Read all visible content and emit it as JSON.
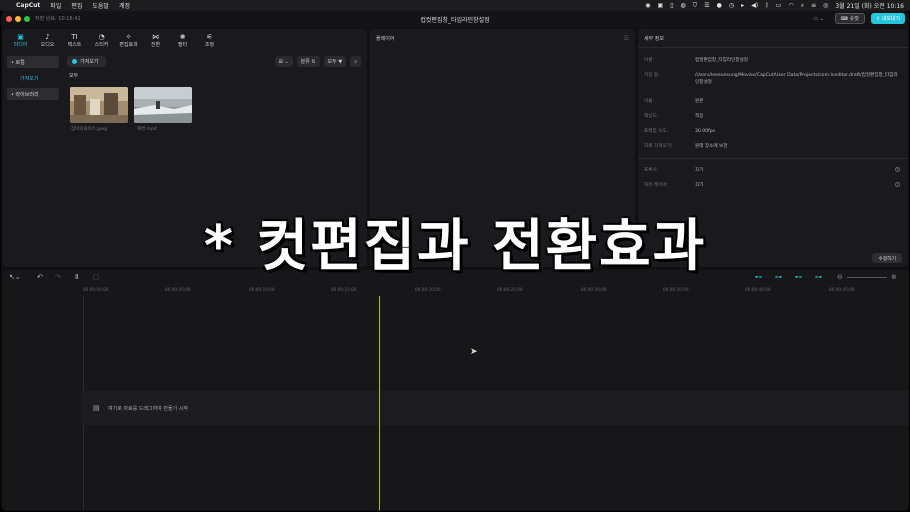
{
  "menubar": {
    "app_name": "CapCut",
    "menus": [
      "파일",
      "편집",
      "도움말",
      "계정"
    ],
    "clock": "3월 21일 (화) 오전 10:16"
  },
  "window": {
    "saved_text": "저장 완료: 10:16:41",
    "title": "컵컷편집창_타임라인창설정",
    "shortcut_label": "숏컷",
    "export_label": "내보내기"
  },
  "tool_tabs": [
    {
      "label": "미디어",
      "icon": "media-icon",
      "glyph": "▣",
      "active": true
    },
    {
      "label": "오디오",
      "icon": "audio-icon",
      "glyph": "♪",
      "active": false
    },
    {
      "label": "텍스트",
      "icon": "text-icon",
      "glyph": "TI",
      "active": false
    },
    {
      "label": "스티커",
      "icon": "sticker-icon",
      "glyph": "◔",
      "active": false
    },
    {
      "label": "편집효과",
      "icon": "effects-icon",
      "glyph": "✧",
      "active": false
    },
    {
      "label": "전환",
      "icon": "transition-icon",
      "glyph": "⋈",
      "active": false
    },
    {
      "label": "필터",
      "icon": "filter-icon",
      "glyph": "❀",
      "active": false
    },
    {
      "label": "조정",
      "icon": "adjust-icon",
      "glyph": "⚟",
      "active": false
    }
  ],
  "media_sidebar": {
    "local": "• 로컬",
    "import": "가져오기",
    "library": "• 라이브러리"
  },
  "media": {
    "import_button": "가져오기",
    "view_label": "⊞",
    "sort_label": "분류",
    "filter_label": "모두",
    "all_label": "모두",
    "items": [
      {
        "name": "장미의화이트.jpeg"
      },
      {
        "name": "해변.mp4"
      }
    ]
  },
  "player": {
    "title": "플레이어",
    "menu": "☰"
  },
  "details": {
    "title": "세부 정보",
    "rows": [
      {
        "key": "이름:",
        "value": "컵컷편집창_타임라인창설정"
      },
      {
        "key": "저장 동:",
        "value": "/Users/leeeunsung/Movies/CapCut/User Data/Projects/com.lveditor.draft/컵컷편집창_타임라인창설정"
      },
      {
        "key": "비율:",
        "value": "원본"
      },
      {
        "key": "해상도:",
        "value": "적응"
      },
      {
        "key": "프레임 속도:",
        "value": "30.00fps"
      },
      {
        "key": "자료 가져오기:",
        "value": "원래 장소에 보관"
      },
      {
        "key": "프록시:",
        "value": "끄기"
      },
      {
        "key": "자유 레이어:",
        "value": "끄기"
      }
    ],
    "modify_button": "수정하기"
  },
  "timeline": {
    "ticks": [
      "00:00:00:00",
      "00:00:05:00",
      "00:00:10:00",
      "00:00:15:00",
      "00:00:20:00",
      "00:00:25:00",
      "00:00:30:00",
      "00:00:35:00",
      "00:00:40:00",
      "00:00:45:00"
    ],
    "drop_hint": "여기로 자료를 드래그하여 만들기 시작"
  },
  "overlay_text": "* 컷편집과 전환효과"
}
